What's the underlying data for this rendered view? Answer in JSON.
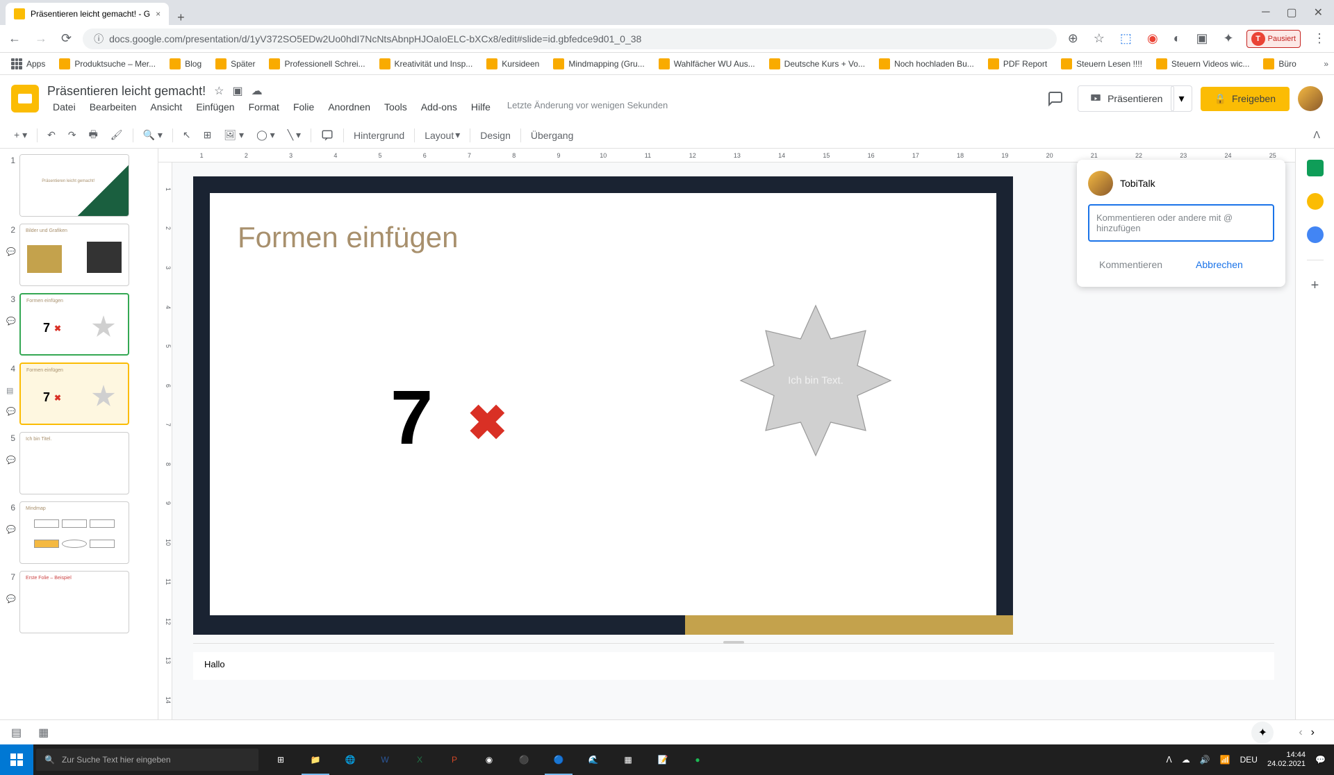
{
  "browser": {
    "tab_title": "Präsentieren leicht gemacht! - G",
    "url": "docs.google.com/presentation/d/1yV372SO5EDw2Uo0hdI7NcNtsAbnpHJOaIoELC-bXCx8/edit#slide=id.gbfedce9d01_0_38",
    "paused": "Pausiert"
  },
  "bookmarks": {
    "apps": "Apps",
    "items": [
      "Produktsuche – Mer...",
      "Blog",
      "Später",
      "Professionell Schrei...",
      "Kreativität und Insp...",
      "Kursideen",
      "Mindmapping (Gru...",
      "Wahlfächer WU Aus...",
      "Deutsche Kurs + Vo...",
      "Noch hochladen Bu...",
      "PDF Report",
      "Steuern Lesen !!!!",
      "Steuern Videos wic...",
      "Büro"
    ]
  },
  "doc": {
    "title": "Präsentieren leicht gemacht!",
    "last_edit": "Letzte Änderung vor wenigen Sekunden"
  },
  "menus": [
    "Datei",
    "Bearbeiten",
    "Ansicht",
    "Einfügen",
    "Format",
    "Folie",
    "Anordnen",
    "Tools",
    "Add-ons",
    "Hilfe"
  ],
  "header_buttons": {
    "present": "Präsentieren",
    "share": "Freigeben"
  },
  "toolbar": {
    "background": "Hintergrund",
    "layout": "Layout",
    "design": "Design",
    "transition": "Übergang"
  },
  "ruler_h": [
    "1",
    "2",
    "3",
    "4",
    "5",
    "6",
    "7",
    "8",
    "9",
    "10",
    "11",
    "12",
    "13",
    "14",
    "15",
    "16",
    "17",
    "18",
    "19",
    "20",
    "21",
    "22",
    "23",
    "24",
    "25"
  ],
  "ruler_v": [
    "1",
    "2",
    "3",
    "4",
    "5",
    "6",
    "7",
    "8",
    "9",
    "10",
    "11",
    "12",
    "13",
    "14"
  ],
  "slides": [
    {
      "num": "1"
    },
    {
      "num": "2"
    },
    {
      "num": "3"
    },
    {
      "num": "4"
    },
    {
      "num": "5"
    },
    {
      "num": "6"
    },
    {
      "num": "7"
    }
  ],
  "current_slide": {
    "heading": "Formen einfügen",
    "seven": "7",
    "x": "✖",
    "star_text": "Ich bin Text."
  },
  "notes": "Hallo",
  "comment": {
    "author": "TobiTalk",
    "placeholder": "Kommentieren oder andere mit @ hinzufügen",
    "submit": "Kommentieren",
    "cancel": "Abbrechen"
  },
  "taskbar": {
    "search_placeholder": "Zur Suche Text hier eingeben",
    "lang": "DEU",
    "time": "14:44",
    "date": "24.02.2021"
  }
}
